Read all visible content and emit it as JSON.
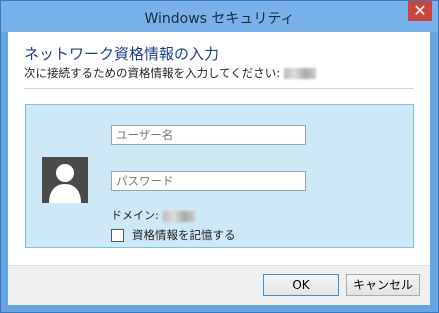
{
  "window": {
    "title": "Windows セキュリティ",
    "close_glyph": "✕"
  },
  "dialog": {
    "heading": "ネットワーク資格情報の入力",
    "instruction": "次に接続するための資格情報を入力してください:"
  },
  "credentials": {
    "username_placeholder": "ユーザー名",
    "password_placeholder": "パスワード",
    "domain_label": "ドメイン:",
    "remember_label": "資格情報を記憶する"
  },
  "buttons": {
    "ok": "OK",
    "cancel": "キャンセル"
  },
  "icons": {
    "avatar": "user-silhouette-icon",
    "close": "close-icon"
  }
}
